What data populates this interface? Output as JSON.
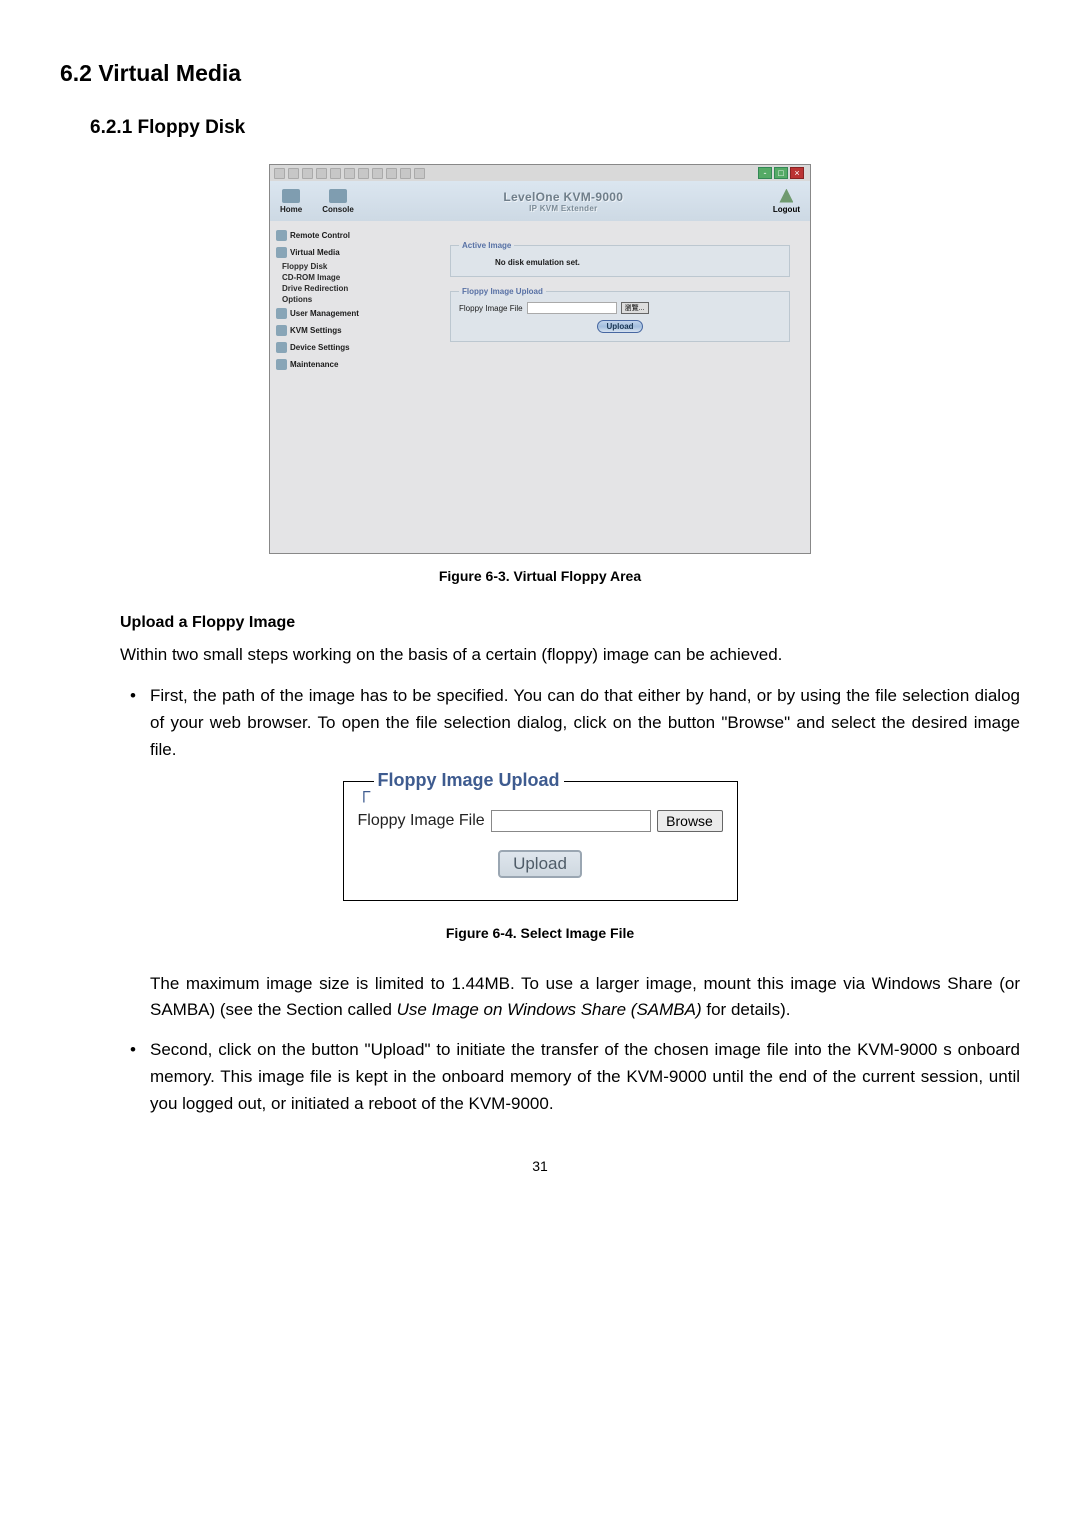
{
  "headings": {
    "h1": "6.2    Virtual Media",
    "h2": "6.2.1  Floppy Disk",
    "h3_upload": "Upload a Floppy Image"
  },
  "fig63": {
    "header": {
      "home": "Home",
      "console": "Console",
      "product": "LevelOne KVM-9000",
      "product_sub": "IP KVM Extender",
      "logout": "Logout"
    },
    "sidebar": {
      "remote_control": "Remote Control",
      "virtual_media": "Virtual Media",
      "floppy_disk": "Floppy Disk",
      "cdrom_image": "CD-ROM Image",
      "drive_redirection": "Drive Redirection",
      "options": "Options",
      "user_management": "User Management",
      "kvm_settings": "KVM Settings",
      "device_settings": "Device Settings",
      "maintenance": "Maintenance"
    },
    "content": {
      "active_image_legend": "Active Image",
      "active_image_text": "No disk emulation set.",
      "upload_legend": "Floppy Image Upload",
      "upload_label": "Floppy Image File",
      "browse_label": "瀏覽...",
      "upload_button": "Upload"
    },
    "caption": "Figure 6-3. Virtual Floppy Area"
  },
  "body_text": {
    "p1": "Within two small steps working on the basis of a certain (floppy) image can be achieved.",
    "li1": "First, the path of the image has to be specified. You can do that either by hand, or by using the file selection dialog of your web browser. To open the file selection dialog, click on the button \"Browse\" and select the desired image file.",
    "p2a": "The maximum image size is limited to 1.44MB. To use a larger image, mount this image via Windows Share (or SAMBA) (see the Section called ",
    "p2_italic": "Use Image on Windows Share (SAMBA)",
    "p2b": " for details).",
    "li2": "Second, click on the button \"Upload\" to initiate the transfer of the chosen image file into the KVM-9000 s onboard memory. This image file is kept in the onboard memory of the KVM-9000 until the end of the current session, until you logged out, or initiated a reboot of the KVM-9000."
  },
  "fig64": {
    "legend": "Floppy Image Upload",
    "label": "Floppy Image File",
    "browse": "Browse",
    "upload": "Upload",
    "caption": "Figure 6-4. Select Image File"
  },
  "page_number": "31"
}
